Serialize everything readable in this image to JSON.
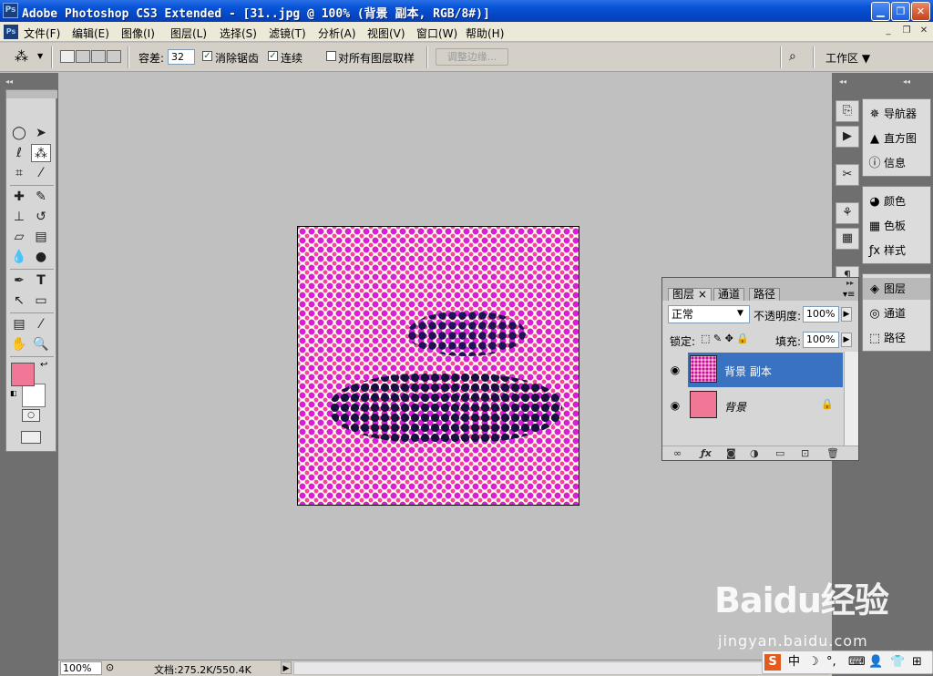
{
  "window": {
    "title": "Adobe Photoshop CS3 Extended - [31..jpg @ 100% (背景 副本, RGB/8#)]",
    "app_icon": "Ps",
    "buttons": [
      "minimize",
      "restore",
      "close"
    ]
  },
  "menu": {
    "items": [
      "文件(F)",
      "编辑(E)",
      "图像(I)",
      "图层(L)",
      "选择(S)",
      "滤镜(T)",
      "分析(A)",
      "视图(V)",
      "窗口(W)",
      "帮助(H)"
    ]
  },
  "options": {
    "tolerance_label": "容差:",
    "tolerance_value": "32",
    "anti_alias_label": "消除锯齿",
    "anti_alias_checked": true,
    "contiguous_label": "连续",
    "contiguous_checked": true,
    "all_layers_label": "对所有图层取样",
    "all_layers_checked": false,
    "refine_edge_label": "调整边缘...",
    "workspace_label": "工作区 ▼"
  },
  "tools": {
    "foreground_color": "#f07896",
    "background_color": "#ffffff",
    "icons": [
      "marquee-icon",
      "move-icon",
      "lasso-icon",
      "magic-wand-icon",
      "crop-icon",
      "slice-icon",
      "healing-icon",
      "brush-icon",
      "stamp-icon",
      "history-brush-icon",
      "eraser-icon",
      "gradient-icon",
      "blur-icon",
      "dodge-icon",
      "pen-icon",
      "type-icon",
      "path-select-icon",
      "shape-icon",
      "notes-icon",
      "eyedropper-icon",
      "hand-icon",
      "zoom-icon"
    ]
  },
  "status": {
    "zoom": "100%",
    "doc": "文档:275.2K/550.4K"
  },
  "dock": {
    "panels_group1": [
      {
        "label": "导航器",
        "icon": "navigator-icon"
      },
      {
        "label": "直方图",
        "icon": "histogram-icon"
      },
      {
        "label": "信息",
        "icon": "info-icon"
      }
    ],
    "panels_group2": [
      {
        "label": "颜色",
        "icon": "color-icon"
      },
      {
        "label": "色板",
        "icon": "swatches-icon"
      },
      {
        "label": "样式",
        "icon": "styles-icon"
      }
    ],
    "panels_group3": [
      {
        "label": "图层",
        "icon": "layers-icon"
      },
      {
        "label": "通道",
        "icon": "channels-icon"
      },
      {
        "label": "路径",
        "icon": "paths-icon"
      }
    ]
  },
  "layers_panel": {
    "tabs": [
      "图层 ×",
      "通道",
      "路径"
    ],
    "blend_mode": "正常",
    "opacity_label": "不透明度:",
    "opacity_value": "100%",
    "lock_label": "锁定:",
    "fill_label": "填充:",
    "fill_value": "100%",
    "layers": [
      {
        "name": "背景 副本",
        "selected": true,
        "locked": false
      },
      {
        "name": "背景",
        "selected": false,
        "locked": true
      }
    ]
  },
  "watermark": {
    "logo": "Baidu经验",
    "url": "jingyan.baidu.com"
  },
  "tray": {
    "items": [
      "S",
      "中",
      "☽",
      "°,",
      "⌨",
      "👤",
      "👕",
      "⊞"
    ]
  }
}
